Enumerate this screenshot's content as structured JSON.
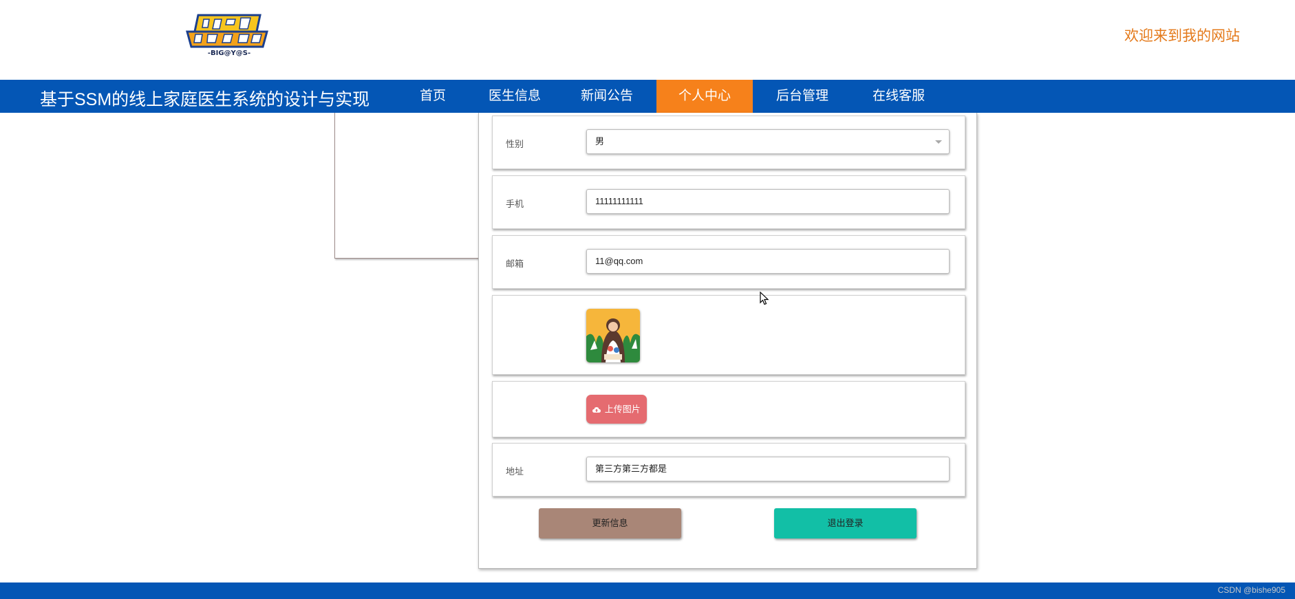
{
  "header": {
    "logo_alt": "Digimon Adventure logo",
    "welcome_text": "欢迎来到我的网站"
  },
  "navbar": {
    "site_title": "基于SSM的线上家庭医生系统的设计与实现",
    "items": [
      {
        "label": "首页",
        "active": false
      },
      {
        "label": "医生信息",
        "active": false
      },
      {
        "label": "新闻公告",
        "active": false
      },
      {
        "label": "个人中心",
        "active": true
      },
      {
        "label": "后台管理",
        "active": false
      },
      {
        "label": "在线客服",
        "active": false
      }
    ]
  },
  "form": {
    "gender": {
      "label": "性别",
      "value": "男"
    },
    "phone": {
      "label": "手机",
      "value": "11111111111"
    },
    "email": {
      "label": "邮箱",
      "value": "11@qq.com"
    },
    "upload": {
      "label": "上传图片",
      "icon": "cloud-upload-icon"
    },
    "address": {
      "label": "地址",
      "value": "第三方第三方都是"
    }
  },
  "actions": {
    "update_label": "更新信息",
    "logout_label": "退出登录"
  },
  "footer": {
    "watermark": "CSDN @bishe905"
  },
  "colors": {
    "nav_bg": "#0456b5",
    "nav_active": "#f6811b",
    "welcome": "#e47a1b",
    "upload_btn": "#e56b70",
    "update_btn": "#a98677",
    "logout_btn": "#12bfa6"
  }
}
